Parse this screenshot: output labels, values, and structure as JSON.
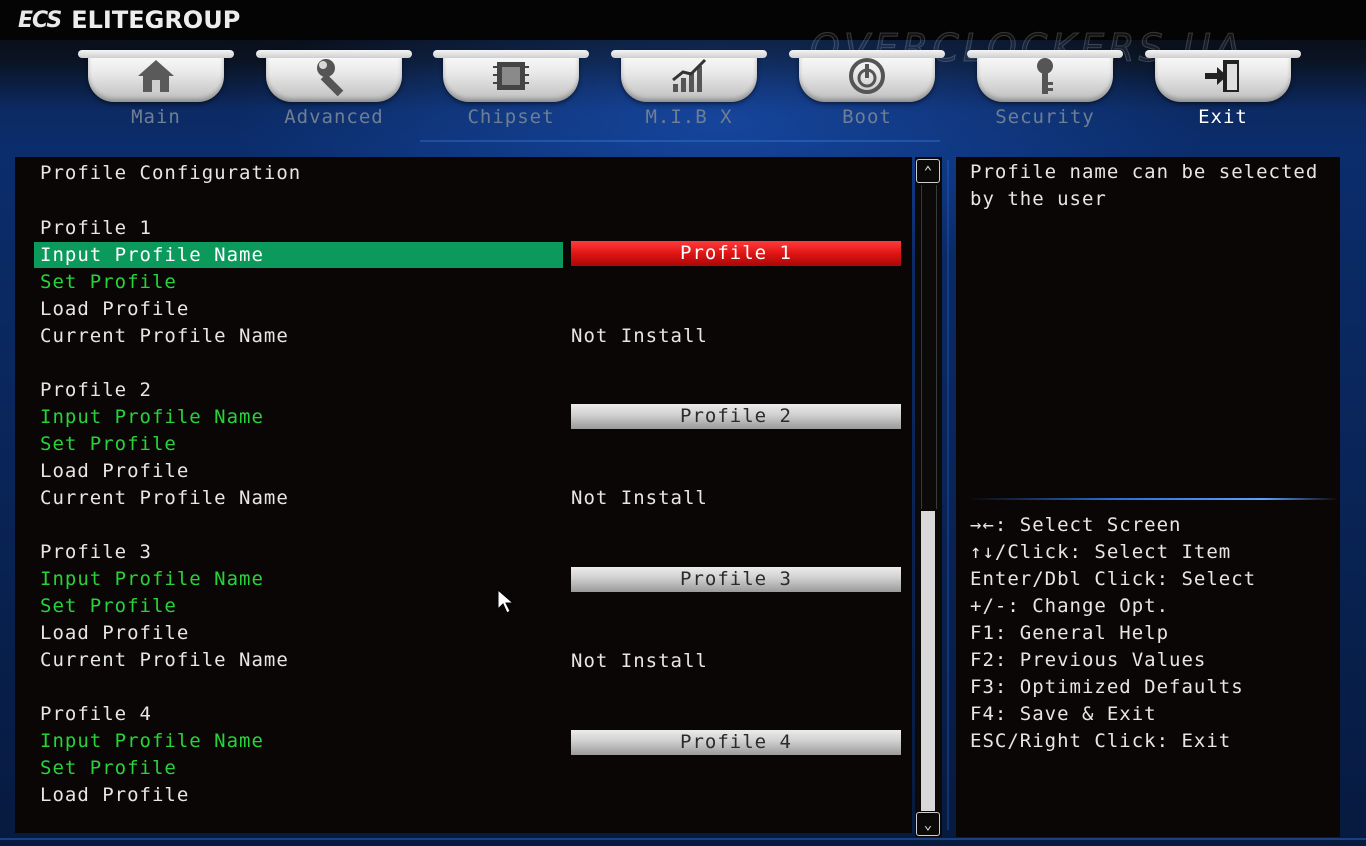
{
  "header": {
    "logo_mark": "ECS",
    "brand": "ELITEGROUP",
    "watermark": "OVERCLOCKERS.UA"
  },
  "tabs": [
    {
      "label": "Main",
      "icon": "house-icon"
    },
    {
      "label": "Advanced",
      "icon": "wrench-icon"
    },
    {
      "label": "Chipset",
      "icon": "chip-icon"
    },
    {
      "label": "M.I.B X",
      "icon": "chart-icon"
    },
    {
      "label": "Boot",
      "icon": "power-icon"
    },
    {
      "label": "Security",
      "icon": "key-icon"
    },
    {
      "label": "Exit",
      "icon": "exit-door-icon"
    }
  ],
  "active_tab": "Exit",
  "main": {
    "section_title": "Profile Configuration",
    "profiles": [
      {
        "heading": "Profile 1",
        "input_label": "Input Profile Name",
        "set_label": "Set Profile",
        "load_label": "Load Profile",
        "current_label": "Current Profile Name",
        "name_value": "Profile 1",
        "current_value": "Not Install"
      },
      {
        "heading": "Profile 2",
        "input_label": "Input Profile Name",
        "set_label": "Set Profile",
        "load_label": "Load Profile",
        "current_label": "Current Profile Name",
        "name_value": "Profile 2",
        "current_value": "Not Install"
      },
      {
        "heading": "Profile 3",
        "input_label": "Input Profile Name",
        "set_label": "Set Profile",
        "load_label": "Load Profile",
        "current_label": "Current Profile Name",
        "name_value": "Profile 3",
        "current_value": "Not Install"
      },
      {
        "heading": "Profile 4",
        "input_label": "Input Profile Name",
        "set_label": "Set Profile",
        "load_label": "Load Profile",
        "name_value": "Profile 4"
      }
    ]
  },
  "help": {
    "description": "Profile name can be selected by the user",
    "keys": [
      "→←: Select Screen",
      "↑↓/Click: Select Item",
      "Enter/Dbl Click: Select",
      "+/-: Change Opt.",
      "F1: General Help",
      "F2: Previous Values",
      "F3: Optimized Defaults",
      "F4: Save & Exit",
      "ESC/Right Click: Exit"
    ]
  },
  "scrollbar": {
    "up_glyph": "⌃",
    "down_glyph": "⌄"
  },
  "colors": {
    "selected_row": "#0c9a5c",
    "active_field": "#e01414",
    "configurable_text": "#26d43a",
    "normal_text": "#e6e6e6"
  }
}
